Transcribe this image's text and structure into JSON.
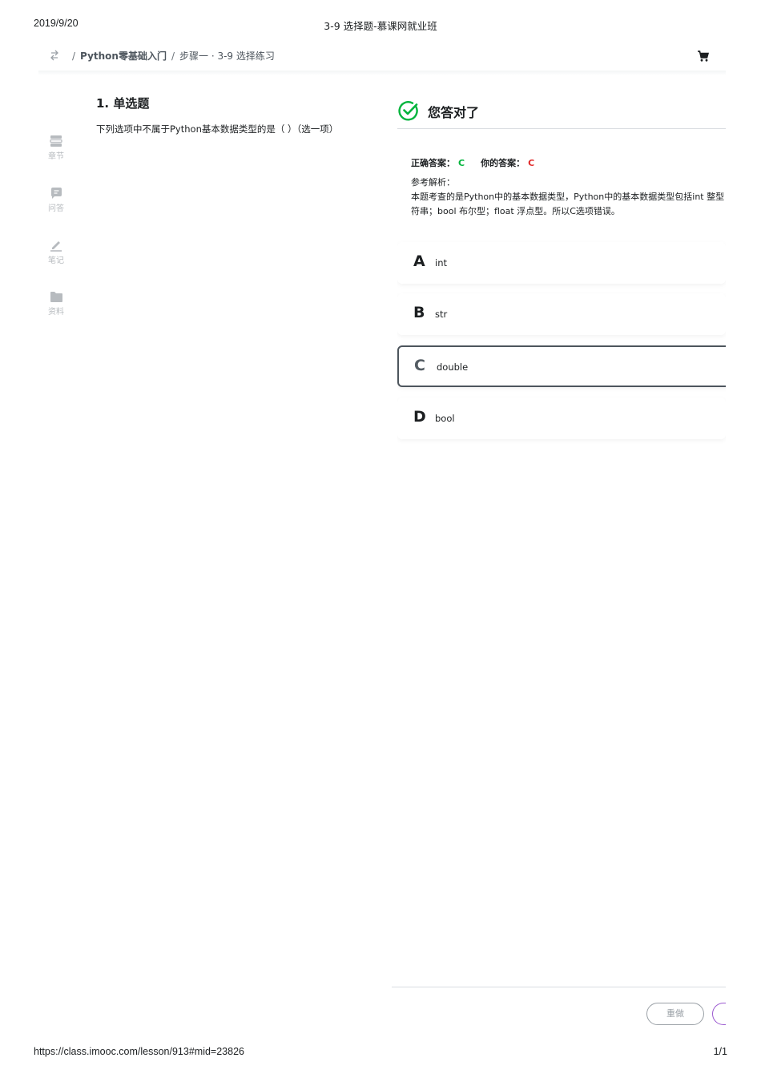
{
  "print_header": {
    "date": "2019/9/20",
    "title": "3-9 选择题-慕课网就业班"
  },
  "print_footer": {
    "url": "https://class.imooc.com/lesson/913#mid=23826",
    "page": "1/1"
  },
  "topbar": {
    "switch_icon": "switch-arrows-icon",
    "breadcrumb": {
      "separator": "/",
      "course": "Python零基础入门",
      "current": "步骤一 · 3-9 选择练习"
    },
    "cart_icon": "cart-icon"
  },
  "sidebar": {
    "items": [
      {
        "label": "章节",
        "icon": "chapter-icon"
      },
      {
        "label": "问答",
        "icon": "qa-icon"
      },
      {
        "label": "笔记",
        "icon": "note-icon"
      },
      {
        "label": "资料",
        "icon": "folder-icon"
      }
    ]
  },
  "question": {
    "title": "1. 单选题",
    "text": "下列选项中不属于Python基本数据类型的是（ ）（选一项）"
  },
  "result": {
    "icon": "check-circle-icon",
    "text": "您答对了",
    "correct_label": "正确答案：",
    "correct_value": "C",
    "yours_label": "你的答案：",
    "yours_value": "C",
    "analysis_label": "参考解析：",
    "analysis_line1": "本题考查的是Python中的基本数据类型，Python中的基本数据类型包括int 整型",
    "analysis_line2": "符串；bool 布尔型；float 浮点型。所以C选项错误。"
  },
  "options": [
    {
      "letter": "A",
      "text": "int",
      "selected": false
    },
    {
      "letter": "B",
      "text": "str",
      "selected": false
    },
    {
      "letter": "C",
      "text": "double",
      "selected": true
    },
    {
      "letter": "D",
      "text": "bool",
      "selected": false
    }
  ],
  "footer_buttons": {
    "redo": "重做"
  },
  "colors": {
    "correct": "#00b43c",
    "yours": "#e12b2b",
    "next_outline": "#9b59d0"
  }
}
